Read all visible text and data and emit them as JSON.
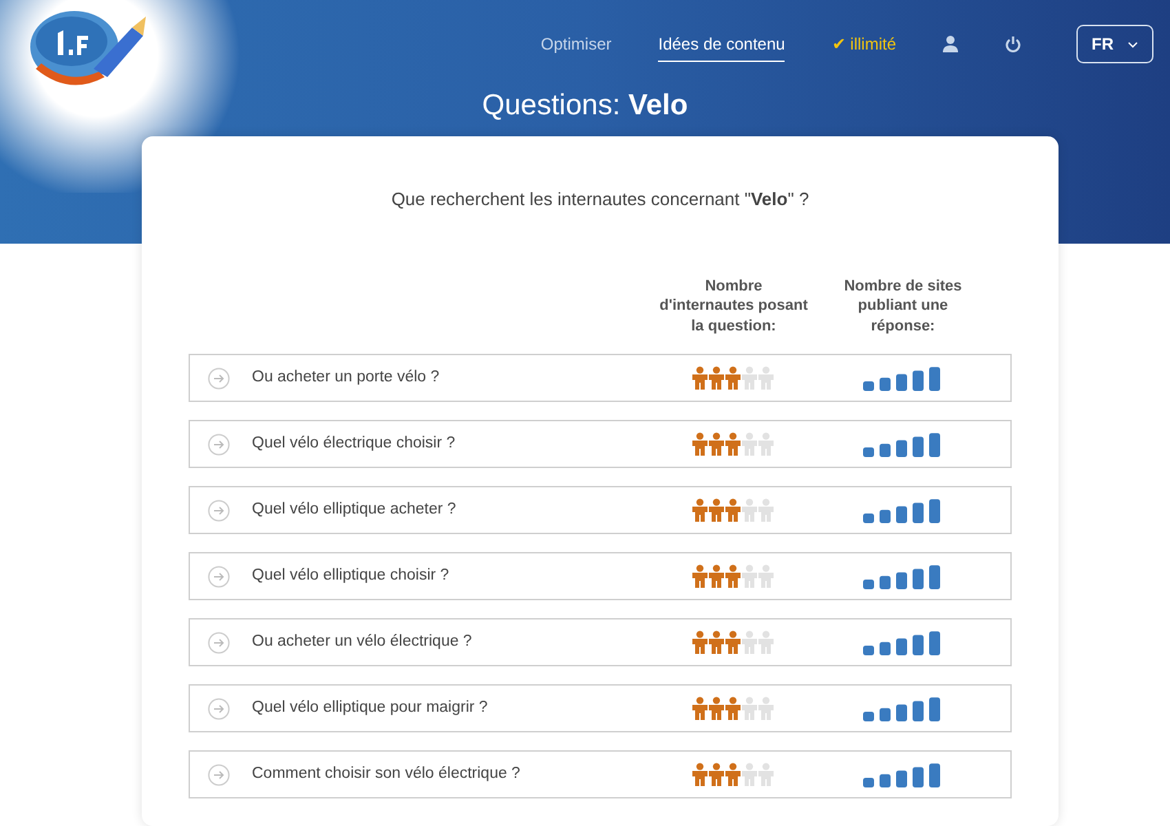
{
  "nav": {
    "items": [
      {
        "label": "Optimiser",
        "selected": false
      },
      {
        "label": "Idées de contenu",
        "selected": true
      }
    ],
    "plan": "✔ illimité",
    "language": "FR"
  },
  "title": {
    "prefix": "Questions: ",
    "keyword": "Velo"
  },
  "card": {
    "question": "Que recherchent les internautes concernant \"**Velo**\" ?",
    "columns": [
      "Nombre d'internautes posant la question:",
      "Nombre de sites publiant une réponse:"
    ],
    "rows": [
      {
        "question": "Ou acheter un porte vélo ?",
        "askers": {
          "stars": 3
        }
      },
      {
        "question": "Quel vélo électrique choisir ?",
        "askers": {
          "stars": 3
        }
      },
      {
        "question": "Quel vélo elliptique acheter ?",
        "askers": {
          "stars": 3
        }
      },
      {
        "question": "Quel vélo elliptique choisir ?",
        "askers": {
          "stars": 3
        }
      },
      {
        "question": "Ou acheter un vélo électrique ?",
        "askers": {
          "stars": 3
        }
      },
      {
        "question": "Quel vélo elliptique pour maigrir ?",
        "askers": {
          "stars": 3
        }
      },
      {
        "question": "Comment choisir son vélo électrique ?",
        "askers": {
          "stars": 3
        }
      }
    ]
  }
}
